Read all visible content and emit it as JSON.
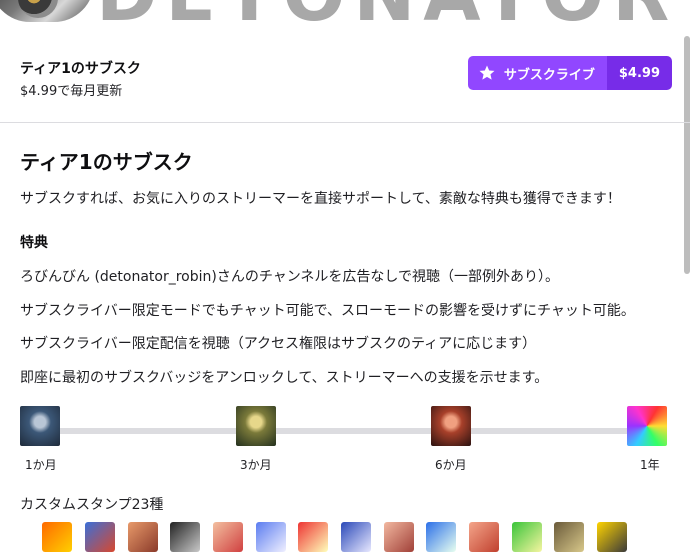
{
  "banner": {
    "text": "DETONATOR"
  },
  "tier": {
    "name": "ティア1のサブスク",
    "price_renewal": "$4.99で毎月更新",
    "subscribe_label": "サブスクライブ",
    "subscribe_price": "$4.99"
  },
  "section": {
    "title": "ティア1のサブスク",
    "description": "サブスクすれば、お気に入りのストリーマーを直接サポートして、素敵な特典も獲得できます！"
  },
  "benefits": {
    "title": "特典",
    "items": [
      "ろびんびん (detonator_robin)さんのチャンネルを広告なしで視聴（一部例外あり）。",
      "サブスクライバー限定モードでもチャット可能で、スローモードの影響を受けずにチャット可能。",
      "サブスクライバー限定配信を視聴（アクセス権限はサブスクのティアに応じます）",
      "即座に最初のサブスクバッジをアンロックして、ストリーマーへの支援を示せます。"
    ]
  },
  "badges": {
    "labels": [
      "1か月",
      "3か月",
      "6か月",
      "1年"
    ],
    "icons": [
      "robot-badge-blue-icon",
      "robot-badge-gold-icon",
      "robot-badge-red-icon",
      "robot-badge-rainbow-icon"
    ]
  },
  "emotes": {
    "title": "カスタムスタンプ23種",
    "icons": [
      "emote-1-icon",
      "emote-2-icon",
      "emote-3-icon",
      "emote-4-icon",
      "emote-5-icon",
      "emote-6-icon",
      "emote-7-icon",
      "emote-8-icon",
      "emote-9-icon",
      "emote-10-icon",
      "emote-11-icon",
      "emote-12-icon",
      "emote-13-icon",
      "emote-14-icon"
    ]
  },
  "colors": {
    "accent": "#9147ff",
    "accent_dark": "#772ce8",
    "text": "#0e0e10",
    "divider": "#dcdce0"
  }
}
